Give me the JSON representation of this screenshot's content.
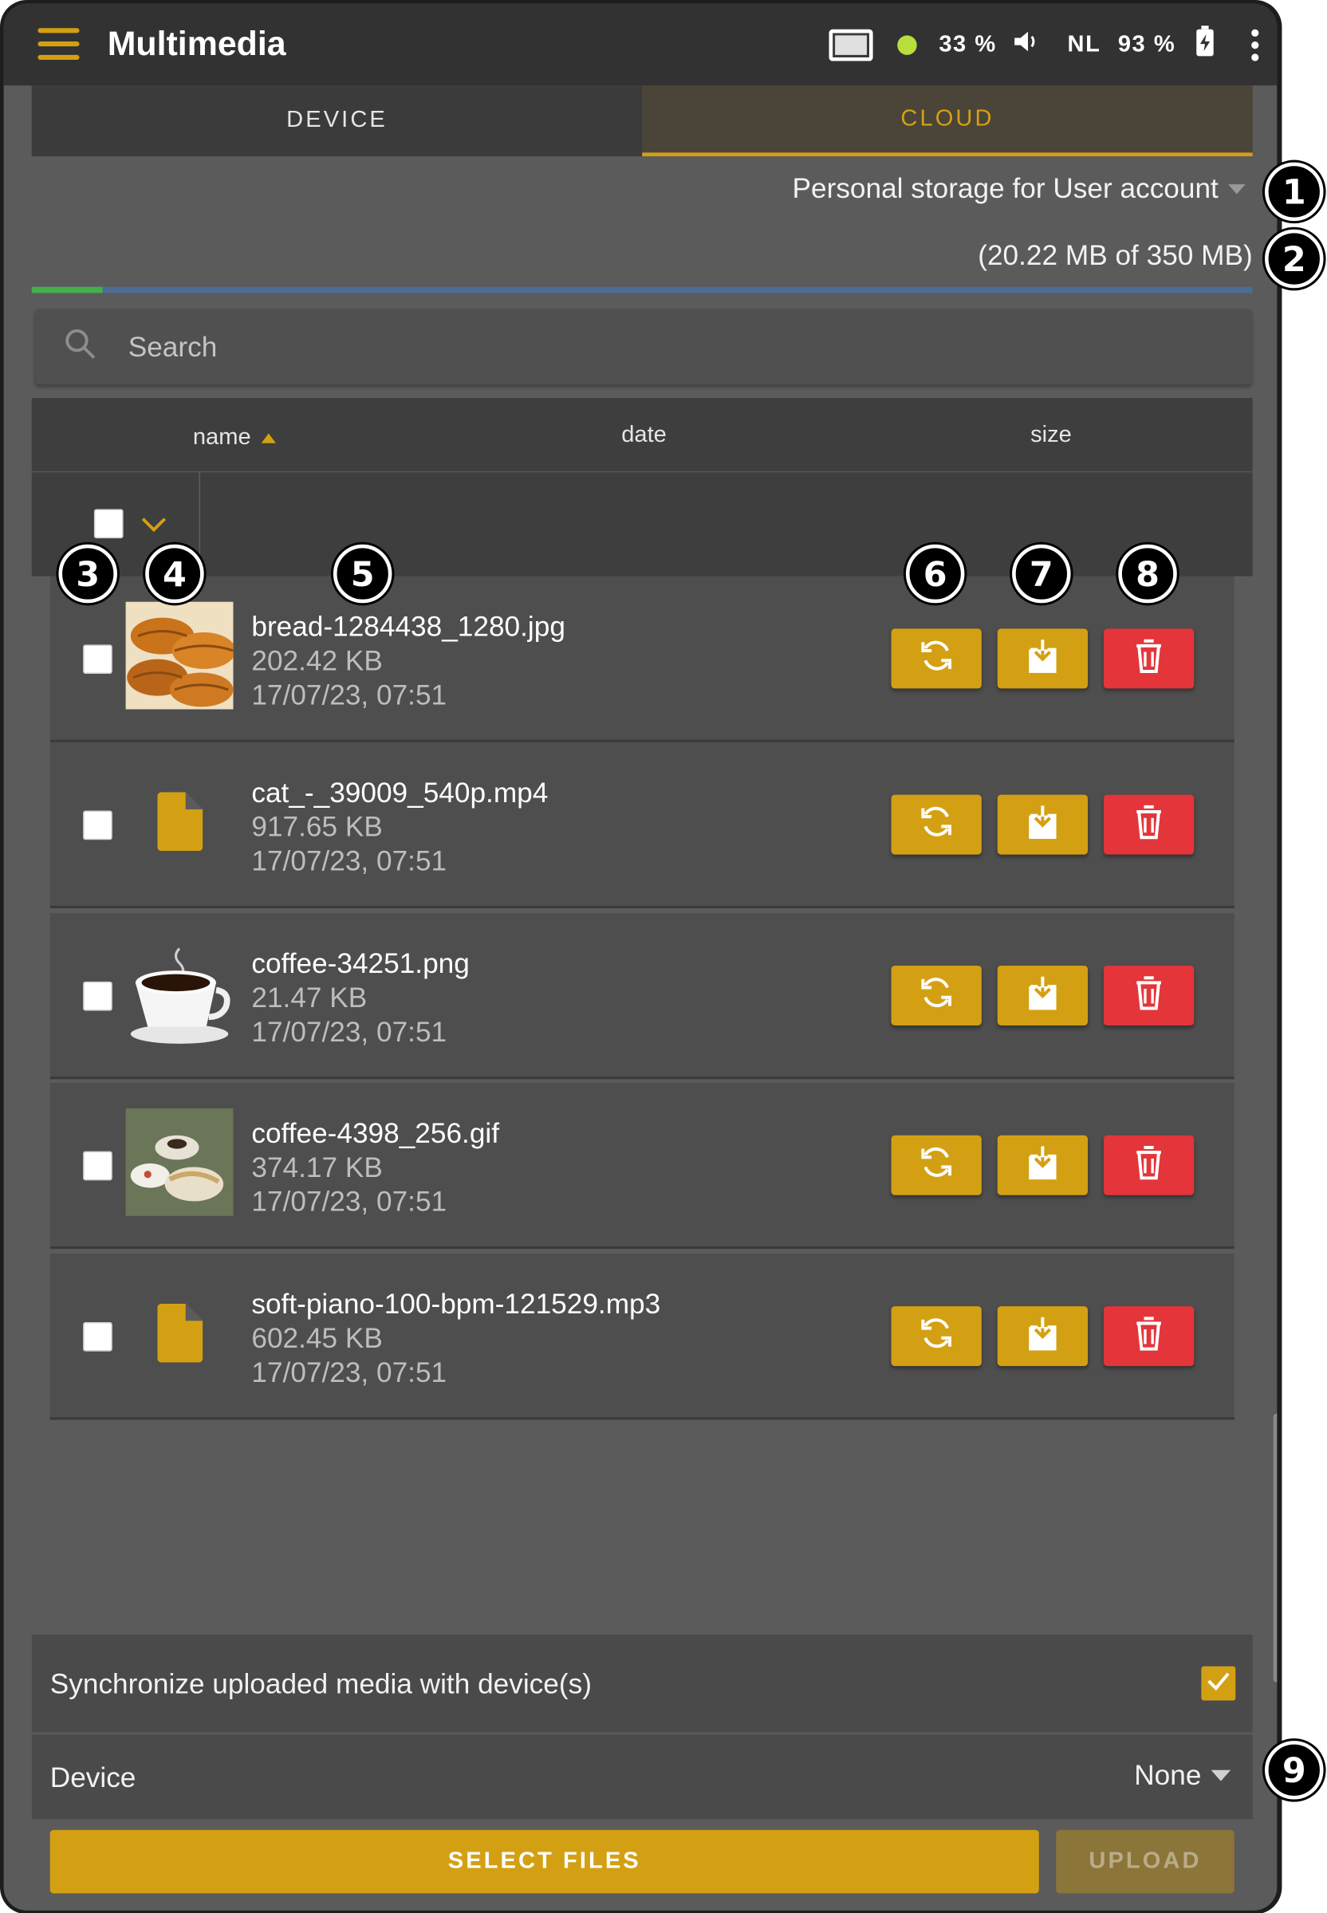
{
  "header": {
    "title": "Multimedia",
    "status": {
      "cpu": "33 %",
      "language": "NL",
      "battery": "93 %"
    }
  },
  "tabs": [
    {
      "label": "DEVICE",
      "active": false
    },
    {
      "label": "CLOUD",
      "active": true
    }
  ],
  "storage": {
    "selected": "Personal storage for User account",
    "quota": "(20.22 MB of 350 MB)",
    "used_fraction": 0.058
  },
  "search": {
    "placeholder": "Search",
    "value": ""
  },
  "table": {
    "columns": [
      "name",
      "date",
      "size"
    ],
    "sort_column": "name",
    "sort_direction": "ascending"
  },
  "files": [
    {
      "name": "bread-1284438_1280.jpg",
      "size": "202.42 KB",
      "date": "17/07/23, 07:51",
      "thumbnail": "bread-image"
    },
    {
      "name": "cat_-_39009_540p.mp4",
      "size": "917.65 KB",
      "date": "17/07/23, 07:51",
      "thumbnail": "file-icon"
    },
    {
      "name": "coffee-34251.png",
      "size": "21.47 KB",
      "date": "17/07/23, 07:51",
      "thumbnail": "coffee-cup-image"
    },
    {
      "name": "coffee-4398_256.gif",
      "size": "374.17 KB",
      "date": "17/07/23, 07:51",
      "thumbnail": "breakfast-image"
    },
    {
      "name": "soft-piano-100-bpm-121529.mp3",
      "size": "602.45 KB",
      "date": "17/07/23, 07:51",
      "thumbnail": "file-icon"
    }
  ],
  "row_actions": [
    "sync-icon",
    "download-icon",
    "trash-icon"
  ],
  "sync": {
    "label": "Synchronize uploaded media with device(s)",
    "checked": true
  },
  "device": {
    "label": "Device",
    "value": "None"
  },
  "buttons": {
    "select_files": "SELECT FILES",
    "upload": "UPLOAD"
  },
  "callouts": [
    "1",
    "2",
    "3",
    "4",
    "5",
    "6",
    "7",
    "8",
    "9"
  ],
  "colors": {
    "accent": "#d4a013",
    "danger": "#e3353a",
    "progress_used": "#43b04a",
    "progress_free": "#4f6b98"
  }
}
